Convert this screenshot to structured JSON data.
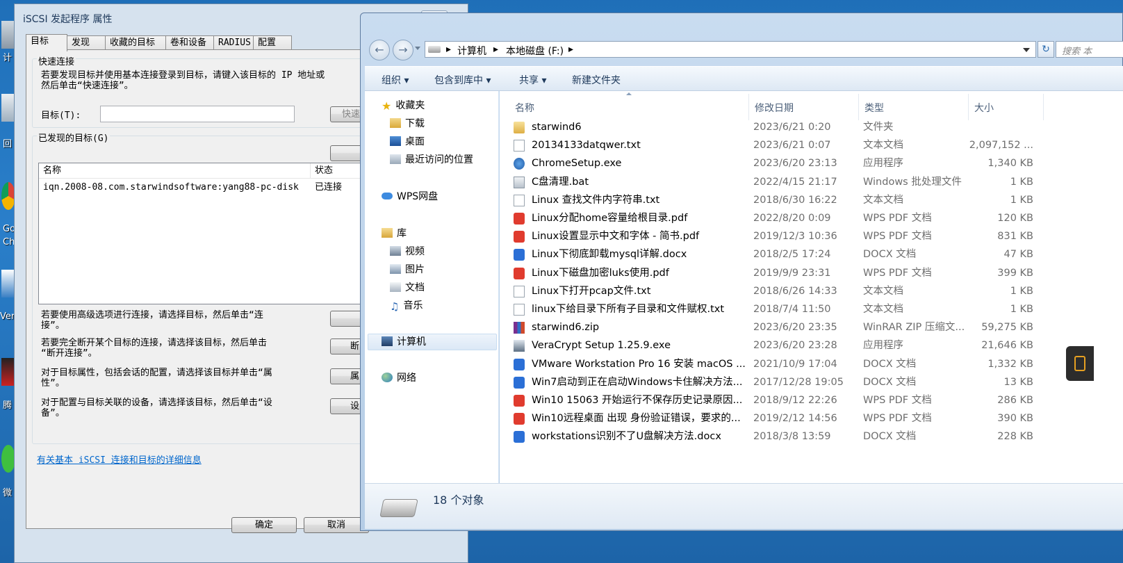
{
  "desktop": {
    "labels": [
      "计",
      "回",
      "Go",
      "Ch",
      "Ver",
      "腾",
      "微"
    ]
  },
  "iscsi": {
    "title": "iSCSI 发起程序 属性",
    "tabs": [
      "目标",
      "发现",
      "收藏的目标",
      "卷和设备",
      "RADIUS",
      "配置"
    ],
    "quick_connect": {
      "group_title": "快速连接",
      "description_line1": "若要发现目标并使用基本连接登录到目标，请键入该目标的 IP 地址或",
      "description_line2": "然后单击“快速连接”。",
      "target_label": "目标(T):",
      "target_value": "",
      "button": "快速"
    },
    "discovered": {
      "group_title": "已发现的目标(G)",
      "columns": [
        "名称",
        "状态"
      ],
      "rows": [
        {
          "name": "iqn.2008-08.com.starwindsoftware:yang88-pc-disk",
          "status": "已连接"
        }
      ]
    },
    "instructions": [
      {
        "line1": "若要使用高级选项进行连接，请选择目标，然后单击“连",
        "line2": "接”。",
        "button": ""
      },
      {
        "line1": "若要完全断开某个目标的连接，请选择该目标，然后单击",
        "line2": "“断开连接”。",
        "button": "断"
      },
      {
        "line1": "对于目标属性，包括会话的配置，请选择该目标并单击“属",
        "line2": "性”。",
        "button": "属"
      },
      {
        "line1": "对于配置与目标关联的设备，请选择该目标，然后单击“设",
        "line2": "备”。",
        "button": "设"
      }
    ],
    "link": "有关基本 iSCSI 连接和目标的详细信息",
    "ok_button": "确定",
    "cancel_button": "取消"
  },
  "explorer": {
    "breadcrumbs": [
      "计算机",
      "本地磁盘 (F:)"
    ],
    "search_placeholder": "搜索 本",
    "toolbar": [
      "组织 ▾",
      "包含到库中 ▾",
      "共享 ▾",
      "新建文件夹"
    ],
    "nav": {
      "favorites": "收藏夹",
      "downloads": "下载",
      "desktop": "桌面",
      "recent": "最近访问的位置",
      "wps": "WPS网盘",
      "libraries": "库",
      "videos": "视频",
      "pictures": "图片",
      "documents": "文档",
      "music": "音乐",
      "computer": "计算机",
      "network": "网络"
    },
    "columns": {
      "name": "名称",
      "date": "修改日期",
      "type": "类型",
      "size": "大小"
    },
    "files": [
      {
        "icon": "folder",
        "name": "starwind6",
        "date": "2023/6/21 0:20",
        "type": "文件夹",
        "size": ""
      },
      {
        "icon": "txt",
        "name": "20134133datqwer.txt",
        "date": "2023/6/21 0:07",
        "type": "文本文档",
        "size": "2,097,152 ..."
      },
      {
        "icon": "exe",
        "name": "ChromeSetup.exe",
        "date": "2023/6/20 23:13",
        "type": "应用程序",
        "size": "1,340 KB"
      },
      {
        "icon": "bat",
        "name": "C盘清理.bat",
        "date": "2022/4/15 21:17",
        "type": "Windows 批处理文件",
        "size": "1 KB"
      },
      {
        "icon": "txt",
        "name": "Linux 查找文件内字符串.txt",
        "date": "2018/6/30 16:22",
        "type": "文本文档",
        "size": "1 KB"
      },
      {
        "icon": "pdf",
        "name": "Linux分配home容量给根目录.pdf",
        "date": "2022/8/20 0:09",
        "type": "WPS PDF 文档",
        "size": "120 KB"
      },
      {
        "icon": "pdf",
        "name": "Linux设置显示中文和字体 - 简书.pdf",
        "date": "2019/12/3 10:36",
        "type": "WPS PDF 文档",
        "size": "831 KB"
      },
      {
        "icon": "docx",
        "name": "Linux下彻底卸载mysql详解.docx",
        "date": "2018/2/5 17:24",
        "type": "DOCX 文档",
        "size": "47 KB"
      },
      {
        "icon": "pdf",
        "name": "Linux下磁盘加密luks使用.pdf",
        "date": "2019/9/9 23:31",
        "type": "WPS PDF 文档",
        "size": "399 KB"
      },
      {
        "icon": "txt",
        "name": "Linux下打开pcap文件.txt",
        "date": "2018/6/26 14:33",
        "type": "文本文档",
        "size": "1 KB"
      },
      {
        "icon": "txt",
        "name": "linux下给目录下所有子目录和文件赋权.txt",
        "date": "2018/7/4 11:50",
        "type": "文本文档",
        "size": "1 KB"
      },
      {
        "icon": "zip",
        "name": "starwind6.zip",
        "date": "2023/6/20 23:35",
        "type": "WinRAR ZIP 压缩文...",
        "size": "59,275 KB"
      },
      {
        "icon": "exe2",
        "name": "VeraCrypt Setup 1.25.9.exe",
        "date": "2023/6/20 23:28",
        "type": "应用程序",
        "size": "21,646 KB"
      },
      {
        "icon": "docx",
        "name": "VMware Workstation Pro 16 安装 macOS ...",
        "date": "2021/10/9 17:04",
        "type": "DOCX 文档",
        "size": "1,332 KB"
      },
      {
        "icon": "docx",
        "name": "Win7启动到正在启动Windows卡住解决方法...",
        "date": "2017/12/28 19:05",
        "type": "DOCX 文档",
        "size": "13 KB"
      },
      {
        "icon": "pdf",
        "name": "Win10 15063 开始运行不保存历史记录原因...",
        "date": "2018/9/12 22:26",
        "type": "WPS PDF 文档",
        "size": "286 KB"
      },
      {
        "icon": "pdf",
        "name": "Win10远程桌面 出现 身份验证错误，要求的...",
        "date": "2019/2/12 14:56",
        "type": "WPS PDF 文档",
        "size": "390 KB"
      },
      {
        "icon": "docx",
        "name": "workstations识别不了U盘解决方法.docx",
        "date": "2018/3/8 13:59",
        "type": "DOCX 文档",
        "size": "228 KB"
      }
    ],
    "status": "18 个对象"
  }
}
